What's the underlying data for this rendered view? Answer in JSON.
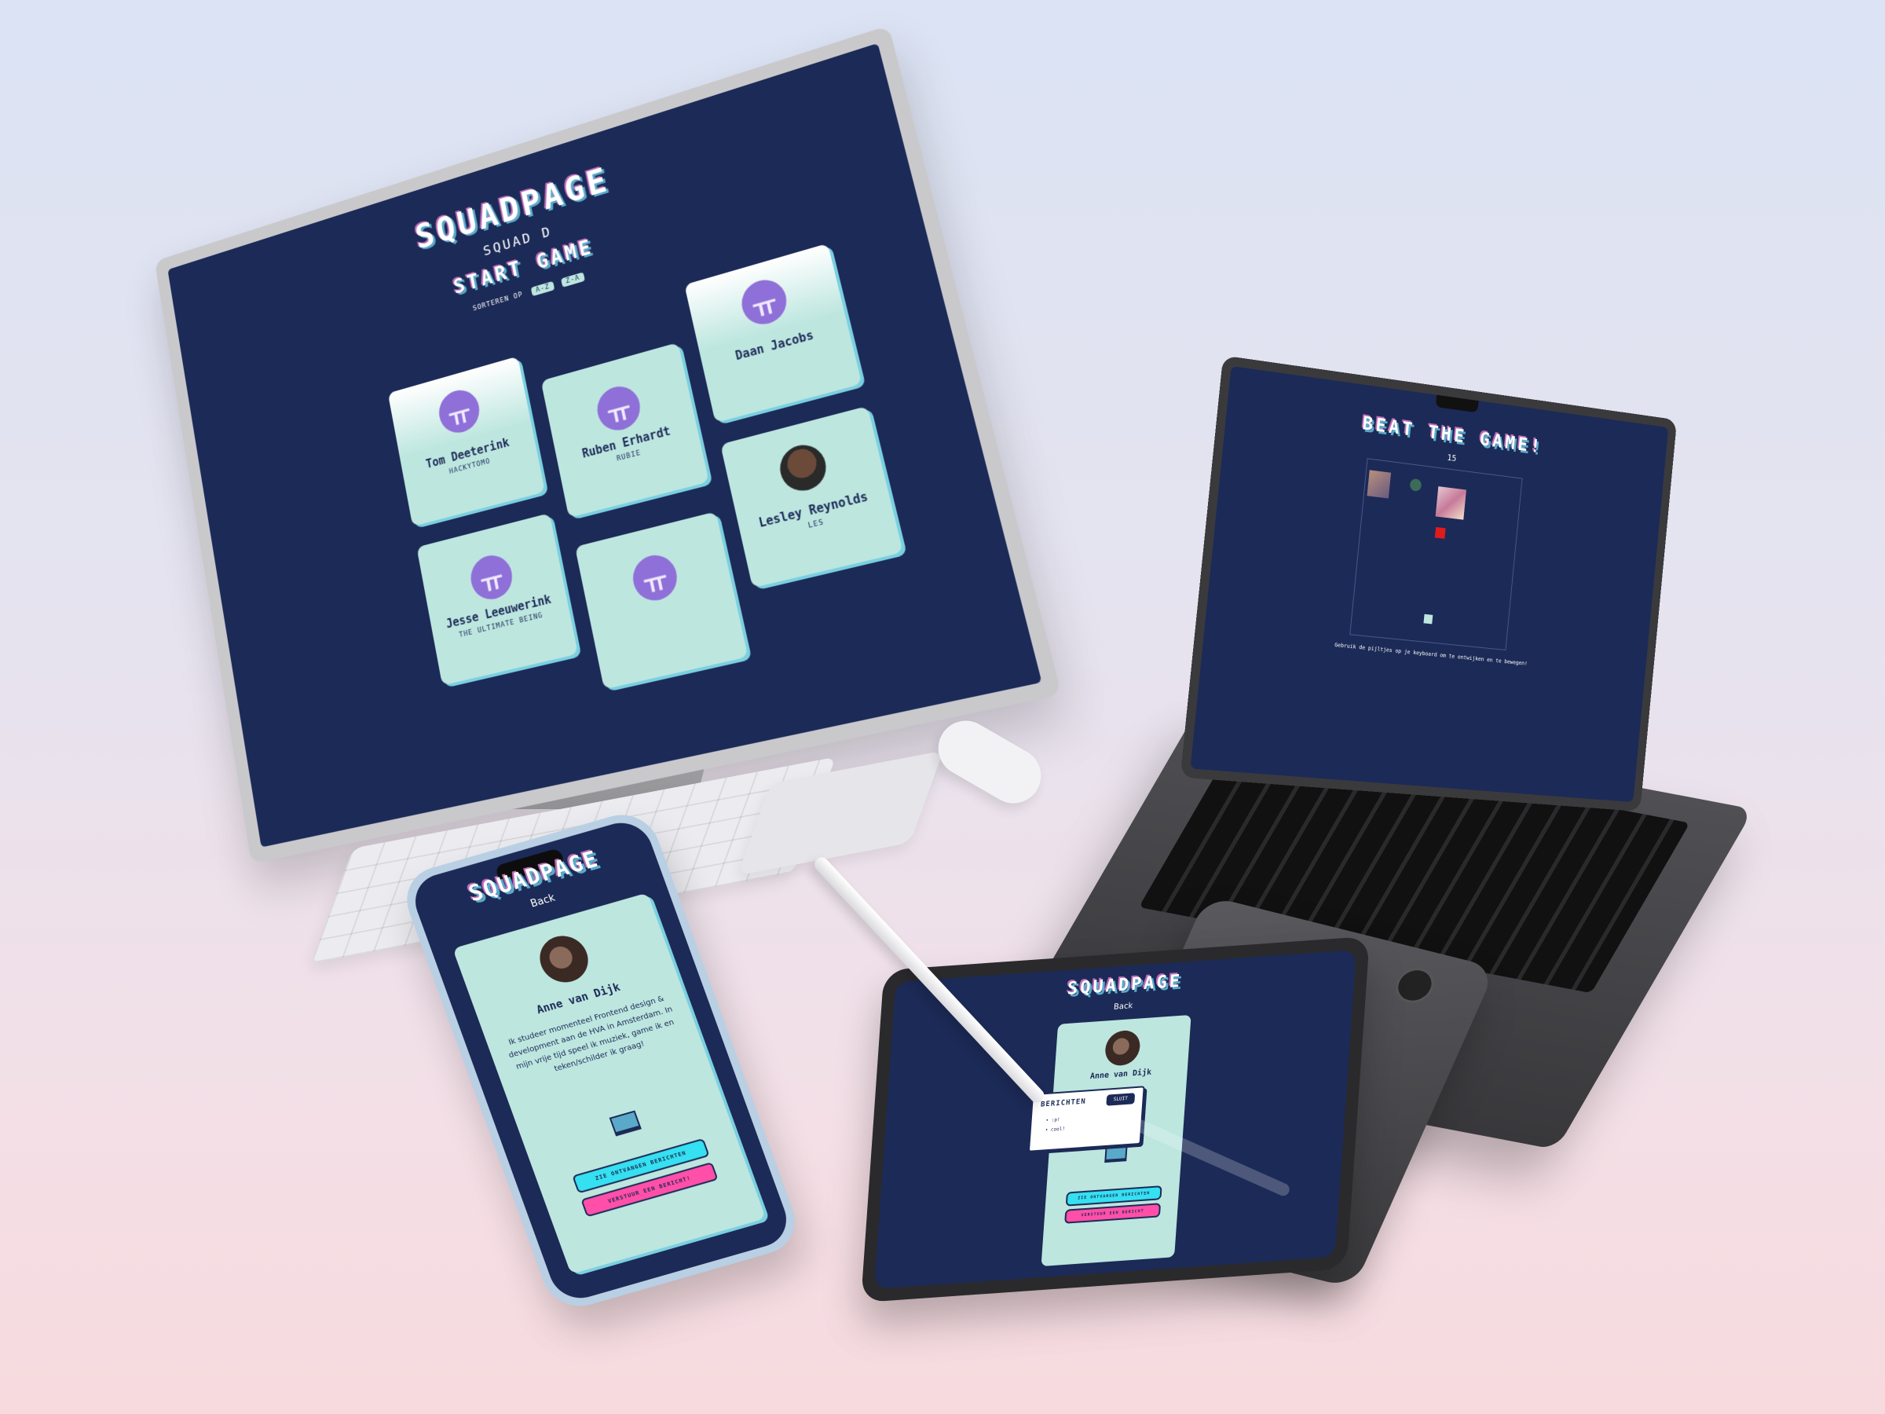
{
  "desktop": {
    "logo": "SQUADPAGE",
    "subtitle": "SQUAD D",
    "start_game": "START GAME",
    "sort_label": "SORTEREN OP",
    "sort_options": [
      "A-Z",
      "Z-A"
    ],
    "cards": [
      {
        "name": "Tom Deeterink",
        "nickname": "HACKYTOMO"
      },
      {
        "name": "Ruben Erhardt",
        "nickname": "RUBIE"
      },
      {
        "name": "Daan Jacobs",
        "nickname": ""
      },
      {
        "name": "Lesley Reynolds",
        "nickname": "LES"
      },
      {
        "name": "Jesse Leeuwerink",
        "nickname": "THE ULTIMATE BEING"
      },
      {
        "name": "",
        "nickname": ""
      }
    ]
  },
  "laptop": {
    "title": "BEAT THE GAME!",
    "score": "15",
    "instructions": "Gebruik de pijltjes op je keyboard om te ontwijken en te bewegen!"
  },
  "phone": {
    "logo": "SQUADPAGE",
    "back": "Back",
    "name": "Anne van Dijk",
    "bio": "Ik studeer momenteel Frontend design & development aan de HVA in Amsterdam. In mijn vrije tijd speel ik muziek, game ik en teken/schilder ik graag!",
    "btn_received": "ZIE ONTVANGEN BERICHTEN",
    "btn_send": "VERSTUUR EEN BERICHT!"
  },
  "tablet": {
    "logo": "SQUADPAGE",
    "back": "Back",
    "name": "Anne van Dijk",
    "modal_title": "BERICHTEN",
    "modal_close": "SLUIT",
    "messages": [
      "• :p!",
      "• cool!"
    ],
    "btn_received": "ZIE ONTVANGEN BERICHTEN",
    "btn_send": "VERSTUUR EEN BERICHT"
  },
  "colors": {
    "screen_bg": "#1c2a57",
    "card_bg": "#bde6df",
    "accent_cyan": "#35e0f0",
    "accent_pink": "#ff4fa8",
    "logo_purple": "#8f6fd8"
  }
}
